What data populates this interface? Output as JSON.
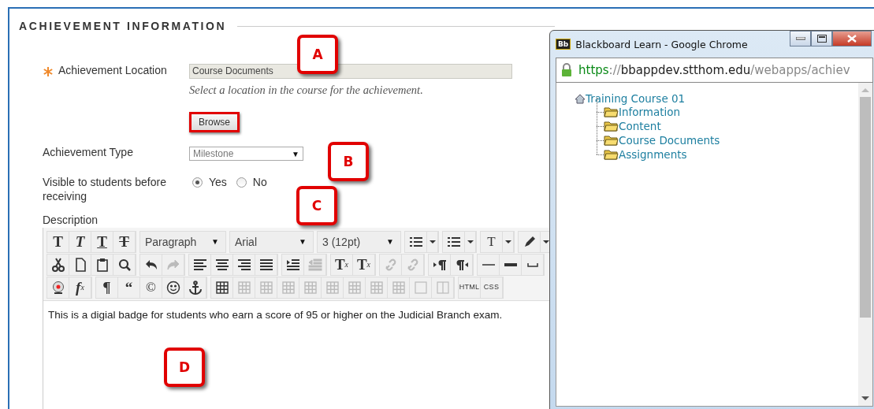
{
  "section": {
    "title": "ACHIEVEMENT INFORMATION"
  },
  "form": {
    "location": {
      "label": "Achievement Location",
      "required": true,
      "value": "Course Documents",
      "hint": "Select a location in the course for the achievement.",
      "button": "Browse"
    },
    "type": {
      "label": "Achievement Type",
      "value": "Milestone",
      "caret": "▼"
    },
    "visible": {
      "label": "Visible to students before receiving",
      "options": [
        {
          "label": "Yes",
          "selected": true
        },
        {
          "label": "No",
          "selected": false
        }
      ]
    },
    "description": {
      "label": "Description",
      "text": "This is a digial badge for students who earn a score of 95 or higher on the Judicial Branch exam."
    }
  },
  "toolbar": [
    [
      [
        {
          "kind": "bold",
          "text": "T"
        },
        {
          "kind": "italic",
          "text": "T"
        },
        {
          "kind": "underline",
          "text": "T"
        },
        {
          "kind": "strike",
          "text": "T"
        }
      ],
      [
        {
          "kind": "select",
          "text": "Paragraph",
          "caret": "▼"
        }
      ],
      [
        {
          "kind": "select",
          "text": "Arial",
          "caret": "▼"
        }
      ],
      [
        {
          "kind": "select",
          "text": "3 (12pt)",
          "caret": "▼"
        }
      ],
      [
        {
          "kind": "bullets"
        },
        {
          "kind": "dropdown"
        }
      ],
      [
        {
          "kind": "numbers"
        },
        {
          "kind": "dropdown"
        }
      ],
      [
        {
          "kind": "plain",
          "text": "T"
        },
        {
          "kind": "dropdown"
        }
      ],
      [
        {
          "kind": "marker"
        },
        {
          "kind": "dropdown"
        }
      ]
    ],
    [
      [
        {
          "kind": "cut"
        },
        {
          "kind": "page"
        },
        {
          "kind": "clipboard"
        },
        {
          "kind": "search"
        }
      ],
      [
        {
          "kind": "undo",
          "disabled": false
        },
        {
          "kind": "redo",
          "disabled": true
        }
      ],
      [
        {
          "kind": "align-left"
        },
        {
          "kind": "align-center"
        },
        {
          "kind": "align-right"
        },
        {
          "kind": "justify"
        }
      ],
      [
        {
          "kind": "indent",
          "disabled": false
        },
        {
          "kind": "outdent",
          "disabled": true
        }
      ],
      [
        {
          "kind": "bold",
          "text": "T",
          "sup": "x"
        },
        {
          "kind": "bold",
          "text": "T",
          "sub": "x"
        }
      ],
      [
        {
          "kind": "link",
          "disabled": true
        },
        {
          "kind": "unlink",
          "disabled": true
        }
      ],
      [
        {
          "kind": "ltr"
        },
        {
          "kind": "rtl"
        }
      ],
      [
        {
          "kind": "rule-thin"
        },
        {
          "kind": "rule-thick"
        },
        {
          "kind": "space"
        }
      ]
    ],
    [
      [
        {
          "kind": "webcam"
        },
        {
          "kind": "italic",
          "text": "f",
          "sub": "x"
        }
      ],
      [
        {
          "kind": "bold",
          "text": "¶"
        },
        {
          "kind": "bold",
          "text": "“"
        },
        {
          "kind": "plain",
          "text": "©"
        },
        {
          "kind": "smiley"
        },
        {
          "kind": "anchor"
        }
      ],
      [
        {
          "kind": "table",
          "disabled": false
        },
        {
          "kind": "table",
          "disabled": true
        },
        {
          "kind": "table",
          "disabled": true
        },
        {
          "kind": "table",
          "disabled": true
        },
        {
          "kind": "table",
          "disabled": true
        },
        {
          "kind": "table",
          "disabled": true
        },
        {
          "kind": "table",
          "disabled": true
        },
        {
          "kind": "table",
          "disabled": true
        },
        {
          "kind": "table",
          "disabled": true
        },
        {
          "kind": "cell",
          "disabled": true
        },
        {
          "kind": "split",
          "disabled": true
        }
      ],
      [
        {
          "kind": "small",
          "text": "HTML"
        },
        {
          "kind": "small",
          "text": "CSS"
        }
      ]
    ]
  ],
  "callouts": [
    {
      "letter": "A"
    },
    {
      "letter": "B"
    },
    {
      "letter": "C"
    },
    {
      "letter": "D"
    }
  ],
  "popup": {
    "title": "Blackboard Learn - Google Chrome",
    "logo": "Bb",
    "url": {
      "scheme": "https",
      "separator": "://",
      "host": "bbappdev.stthom.edu",
      "path": "/webapps/achiev"
    },
    "tree": {
      "label": "Training Course 01",
      "children": [
        {
          "label": "Information"
        },
        {
          "label": "Content"
        },
        {
          "label": "Course Documents"
        },
        {
          "label": "Assignments"
        }
      ]
    }
  }
}
